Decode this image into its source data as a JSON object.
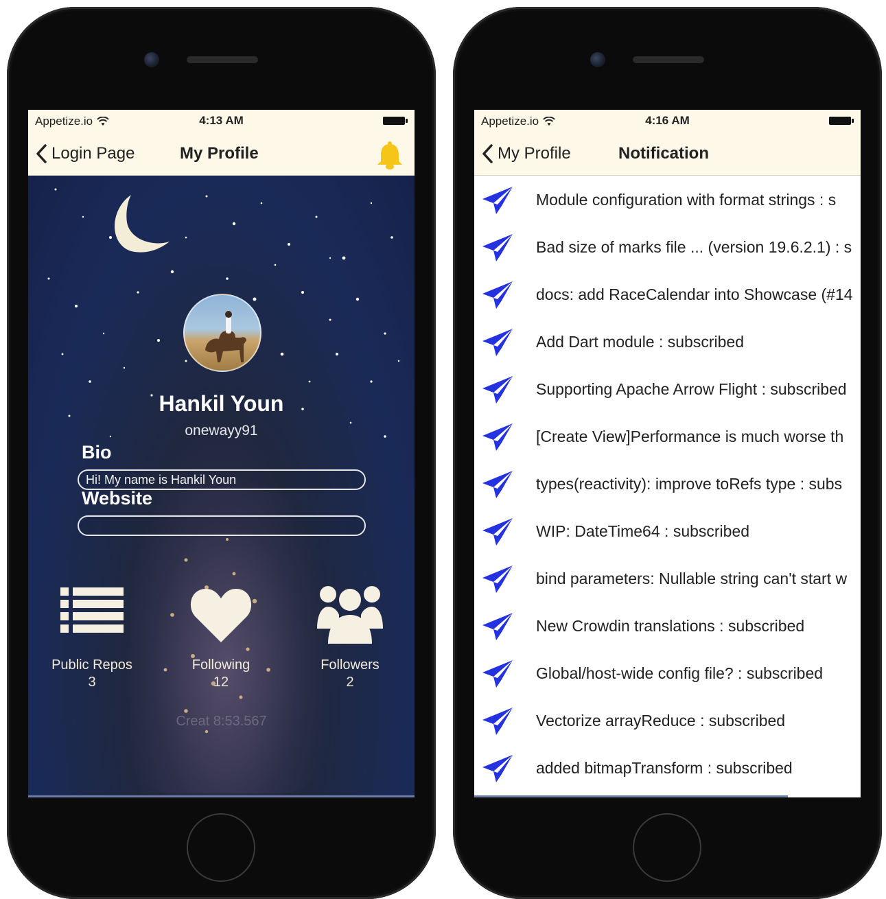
{
  "left_screen": {
    "status_bar": {
      "carrier": "Appetize.io",
      "time": "4:13 AM"
    },
    "nav": {
      "back_label": "Login Page",
      "title": "My Profile"
    },
    "profile": {
      "name": "Hankil Youn",
      "login": "onewayy91",
      "bio_label": "Bio",
      "bio_value": "Hi! My name is Hankil Youn",
      "website_label": "Website",
      "website_value": "",
      "stats": [
        {
          "label": "Public Repos",
          "count": "3"
        },
        {
          "label": "Following",
          "count": "12"
        },
        {
          "label": "Followers",
          "count": "2"
        }
      ],
      "created_text": "Creat                              8:53.567"
    }
  },
  "right_screen": {
    "status_bar": {
      "carrier": "Appetize.io",
      "time": "4:16 AM"
    },
    "nav": {
      "back_label": "My Profile",
      "title": "Notification"
    },
    "notifications": [
      "Module configuration with format strings : s",
      "Bad size of marks file ... (version 19.6.2.1) : s",
      "docs: add RaceCalendar into Showcase (#14",
      "Add Dart module : subscribed",
      "Supporting Apache Arrow Flight : subscribed",
      "[Create View]Performance is much worse th",
      "types(reactivity): improve toRefs type : subs",
      "WIP: DateTime64 : subscribed",
      "bind parameters: Nullable string can't start w",
      "New Crowdin translations : subscribed",
      "Global/host-wide config file? : subscribed",
      "Vectorize arrayReduce : subscribed",
      "added bitmapTransform : subscribed"
    ]
  },
  "colors": {
    "nav_bg": "#fdf8e8",
    "bell": "#f5c518",
    "plane": "#2432e0",
    "stat_icons": "#f5f0e1"
  },
  "icons": {
    "wifi": "wifi-icon",
    "battery": "battery-icon",
    "back": "chevron-left-icon",
    "bell": "bell-icon",
    "repos": "list-icon",
    "following": "heart-icon",
    "followers": "users-icon",
    "notification": "paper-plane-icon"
  }
}
